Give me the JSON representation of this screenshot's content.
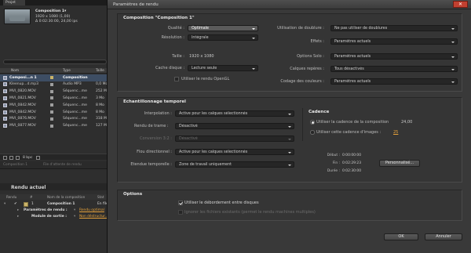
{
  "app": {
    "tab_label": "Projet",
    "project_info": {
      "comp_name": "Composition 1▾",
      "size": "1920 x 1080 (1,00)",
      "duration": "Δ 0:02:30:00, 24,00 ips"
    },
    "columns": [
      "Nom",
      "Type",
      "Taille"
    ],
    "items": [
      {
        "name": "Composi...n 1",
        "type": "Composition",
        "size": "",
        "tag": "#c9b36a",
        "selected": true
      },
      {
        "name": "Kleenup...d.mp3",
        "type": "Audio MP3",
        "size": "0,0 Mo",
        "tag": "#9e9e9e",
        "selected": false
      },
      {
        "name": "MVI_0820.MOV",
        "type": "Séquenc...me",
        "size": "252 Mo",
        "tag": "#9e9e9e",
        "selected": false
      },
      {
        "name": "MVI_0821.MOV",
        "type": "Séquenc...me",
        "size": "3 Mo",
        "tag": "#9e9e9e",
        "selected": false
      },
      {
        "name": "MVI_0842.MOV",
        "type": "Séquenc...me",
        "size": "8 Mo",
        "tag": "#9e9e9e",
        "selected": false
      },
      {
        "name": "MVI_0842.MOV",
        "type": "Séquenc...me",
        "size": "8 Mo",
        "tag": "#9e9e9e",
        "selected": false
      },
      {
        "name": "MVI_0876.MOV",
        "type": "Séquenc...me",
        "size": "318 Mo",
        "tag": "#9e9e9e",
        "selected": false
      },
      {
        "name": "MVI_0877.MOV",
        "type": "Séquenc...me",
        "size": "127 Mo",
        "tag": "#9e9e9e",
        "selected": false
      }
    ],
    "bpc": "8 bpc",
    "panel2_tabs": [
      "Composition 1",
      "File d'attente de rendu"
    ],
    "render_title": "Rendu actuel",
    "render_columns": [
      "Rendu",
      "#",
      "Nom de la composition",
      "Stat"
    ],
    "render_rows": [
      {
        "num": "1",
        "name": "Composition 1",
        "status": "En file"
      },
      {
        "label": "Paramètres de rendu :",
        "value": "Rendu optimal"
      },
      {
        "label": "Module de sortie :",
        "value": "Non déstructur..."
      }
    ]
  },
  "dialog": {
    "title": "Paramètres de rendu",
    "close_symbol": "✕",
    "comp_header": "Composition \"Composition 1\"",
    "quality_label": "Qualité :",
    "quality_value": "Optimale",
    "resolution_label": "Résolution :",
    "resolution_value": "Intégrale",
    "size_label": "Taille :",
    "size_value": "1920 x 1080",
    "cache_label": "Cache disque :",
    "cache_value": "Lecture seule",
    "opengl_label": "Utiliser le rendu OpenGL",
    "proxy_label": "Utilisation de doublure :",
    "proxy_value": "Ne pas utiliser de doublures",
    "effects_label": "Effets :",
    "effects_value": "Paramètres actuels",
    "solo_label": "Options Solo :",
    "solo_value": "Paramètres actuels",
    "guides_label": "Calques repères :",
    "guides_value": "Tous désactivés",
    "color_label": "Codage des couleurs :",
    "color_value": "Paramètres actuels",
    "time_header": "Echantillonnage temporel",
    "interp_label": "Interpolation :",
    "interp_value": "Active pour les calques sélectionnés",
    "frame_label": "Rendu de trame :",
    "frame_value": "Désactivé",
    "pulldown_label": "Conversion 3:2 :",
    "pulldown_value": "Désactivé",
    "blur_label": "Flou directionnel :",
    "blur_value": "Active pour les calques sélectionnés",
    "span_label": "Etendue temporelle :",
    "span_value": "Zone de travail uniquement",
    "cadence_header": "Cadence",
    "cadence_comp_label": "Utiliser la cadence de la composition",
    "cadence_comp_value": "24,00",
    "cadence_custom_label": "Utiliser cette cadence d'images :",
    "cadence_custom_value": "25",
    "start_label": "Début :",
    "start_value": "0:00:00:00",
    "end_label": "Fin :",
    "end_value": "0:02:29:23",
    "custom_button": "Personnalisé...",
    "duration_label": "Durée :",
    "duration_value": "0:02:30:00",
    "options_header": "Options",
    "overflow_label": "Utiliser le débordement entre disques",
    "skip_label": "Ignorer les fichiers existants (permet le rendu machines multiples)",
    "ok_label": "OK",
    "cancel_label": "Annuler"
  }
}
